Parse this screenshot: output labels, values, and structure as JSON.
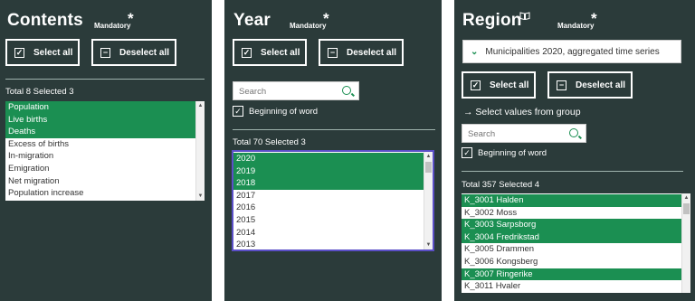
{
  "contents": {
    "title": "Contents",
    "mandatory": "Mandatory",
    "star": "*",
    "select_all": "Select all",
    "deselect_all": "Deselect all",
    "total": "Total 8 Selected 3",
    "items": [
      {
        "label": "Population",
        "selected": true
      },
      {
        "label": "Live births",
        "selected": true
      },
      {
        "label": "Deaths",
        "selected": true
      },
      {
        "label": "Excess of births",
        "selected": false
      },
      {
        "label": "In-migration",
        "selected": false
      },
      {
        "label": "Emigration",
        "selected": false
      },
      {
        "label": "Net migration",
        "selected": false
      },
      {
        "label": "Population increase",
        "selected": false
      }
    ]
  },
  "year": {
    "title": "Year",
    "mandatory": "Mandatory",
    "star": "*",
    "select_all": "Select all",
    "deselect_all": "Deselect all",
    "search_placeholder": "Search",
    "beginning_of_word": "Beginning of word",
    "total": "Total 70 Selected 3",
    "items": [
      {
        "label": "2020",
        "selected": true
      },
      {
        "label": "2019",
        "selected": true
      },
      {
        "label": "2018",
        "selected": true
      },
      {
        "label": "2017",
        "selected": false
      },
      {
        "label": "2016",
        "selected": false
      },
      {
        "label": "2015",
        "selected": false
      },
      {
        "label": "2014",
        "selected": false
      },
      {
        "label": "2013",
        "selected": false
      }
    ]
  },
  "region": {
    "title": "Region",
    "mandatory": "Mandatory",
    "star": "*",
    "dropdown_value": "Municipalities 2020, aggregated time series",
    "select_all": "Select all",
    "deselect_all": "Deselect all",
    "select_from_group": "Select values from group",
    "search_placeholder": "Search",
    "beginning_of_word": "Beginning of word",
    "total": "Total 357 Selected 4",
    "items": [
      {
        "label": "K_3001 Halden",
        "selected": true
      },
      {
        "label": "K_3002 Moss",
        "selected": false
      },
      {
        "label": "K_3003 Sarpsborg",
        "selected": true
      },
      {
        "label": "K_3004 Fredrikstad",
        "selected": true
      },
      {
        "label": "K_3005 Drammen",
        "selected": false
      },
      {
        "label": "K_3006 Kongsberg",
        "selected": false
      },
      {
        "label": "K_3007 Ringerike",
        "selected": true
      },
      {
        "label": "K_3011 Hvaler",
        "selected": false
      }
    ]
  },
  "colors": {
    "panel": "#2b3b3a",
    "selected": "#1b8f52",
    "accent": "#1b8f52"
  },
  "icons": {
    "check": "✓",
    "minus": "−",
    "chevron": "⌄",
    "arrow": "→",
    "book": "book-icon",
    "search": "search-icon"
  }
}
